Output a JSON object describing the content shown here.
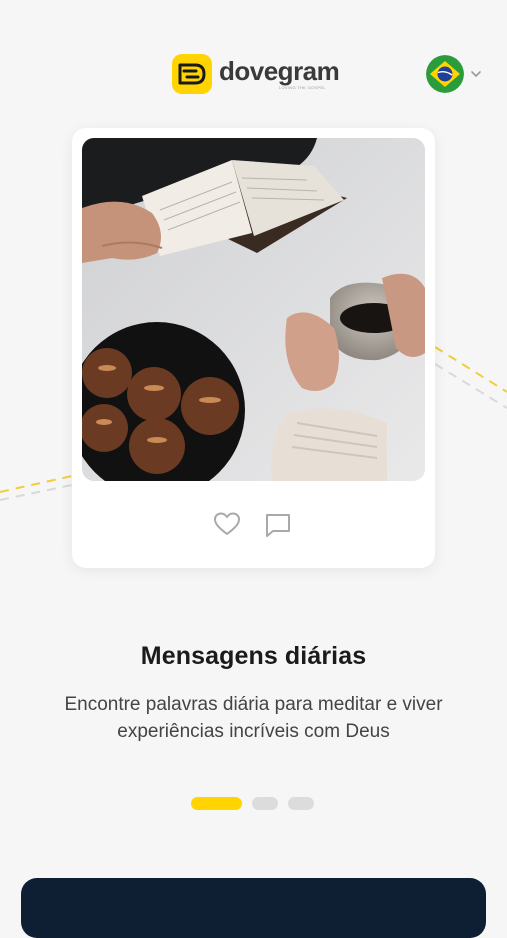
{
  "header": {
    "brand_name": "dovegram",
    "brand_tagline": "LOVING THE GOSPEL",
    "language": {
      "icon": "brazil-flag-icon",
      "selector_icon": "chevron-down-icon"
    }
  },
  "card": {
    "image": "photo-person-reading-book-with-coffee-and-cookies",
    "like_icon": "heart-outline-icon",
    "comment_icon": "comment-outline-icon"
  },
  "onboarding": {
    "title": "Mensagens diárias",
    "description": "Encontre palavras diária para meditar e viver experiências incríveis com Deus",
    "pagination": {
      "total": 3,
      "active": 1
    }
  },
  "colors": {
    "accent": "#ffd400",
    "background": "#f6f6f6",
    "primary_button": "#0f1f33",
    "text_primary": "#1b1b1b",
    "text_secondary": "#444444"
  }
}
